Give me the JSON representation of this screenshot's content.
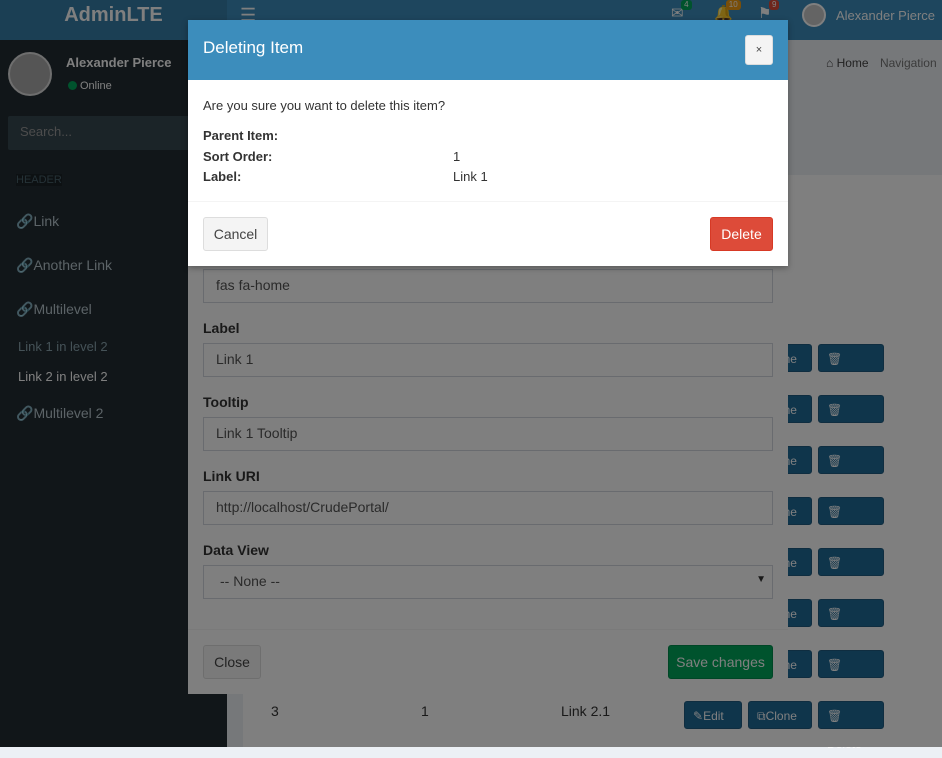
{
  "app": {
    "logo": "AdminLTE",
    "user_name": "Alexander Pierce",
    "notification_badges": {
      "messages": "4",
      "notifications": "10",
      "tasks": "9"
    },
    "colors": {
      "primary": "#3c8dbc",
      "danger": "#dd4b39",
      "success": "#00a65a",
      "sidebar": "#222d32"
    }
  },
  "sidebar": {
    "user_name": "Alexander Pierce",
    "status": "Online",
    "search_placeholder": "Search...",
    "header": "HEADER",
    "items": [
      {
        "label": "Link",
        "icon": "link-icon"
      },
      {
        "label": "Another Link",
        "icon": "link-icon"
      },
      {
        "label": "Multilevel",
        "icon": "link-icon"
      }
    ],
    "subitems": [
      "Link 1 in level 2",
      "Link 2 in level 2"
    ],
    "item_last": {
      "label": "Multilevel 2",
      "icon": "link-icon"
    }
  },
  "breadcrumb": {
    "home": "Home",
    "current": "Navigation"
  },
  "table": {
    "last_row": {
      "id": "3",
      "sort": "1",
      "label": "Link 2.1"
    },
    "actions": {
      "edit": "Edit",
      "clone": "Clone",
      "delete": "Delete"
    },
    "row_count": 8
  },
  "delete_modal": {
    "title": "Deleting Item",
    "close_label": "×",
    "question": "Are you sure you want to delete this item?",
    "fields": [
      {
        "key": "Parent Item:",
        "value": ""
      },
      {
        "key": "Sort Order:",
        "value": "1"
      },
      {
        "key": "Label:",
        "value": "Link 1"
      }
    ],
    "cancel_label": "Cancel",
    "delete_label": "Delete"
  },
  "edit_modal": {
    "icon_value": "fas fa-home",
    "label_label": "Label",
    "label_value": "Link 1",
    "tooltip_label": "Tooltip",
    "tooltip_value": "Link 1 Tooltip",
    "uri_label": "Link URI",
    "uri_value": "http://localhost/CrudePortal/",
    "dataview_label": "Data View",
    "dataview_value": "-- None --",
    "close_label": "Close",
    "save_label": "Save changes"
  }
}
